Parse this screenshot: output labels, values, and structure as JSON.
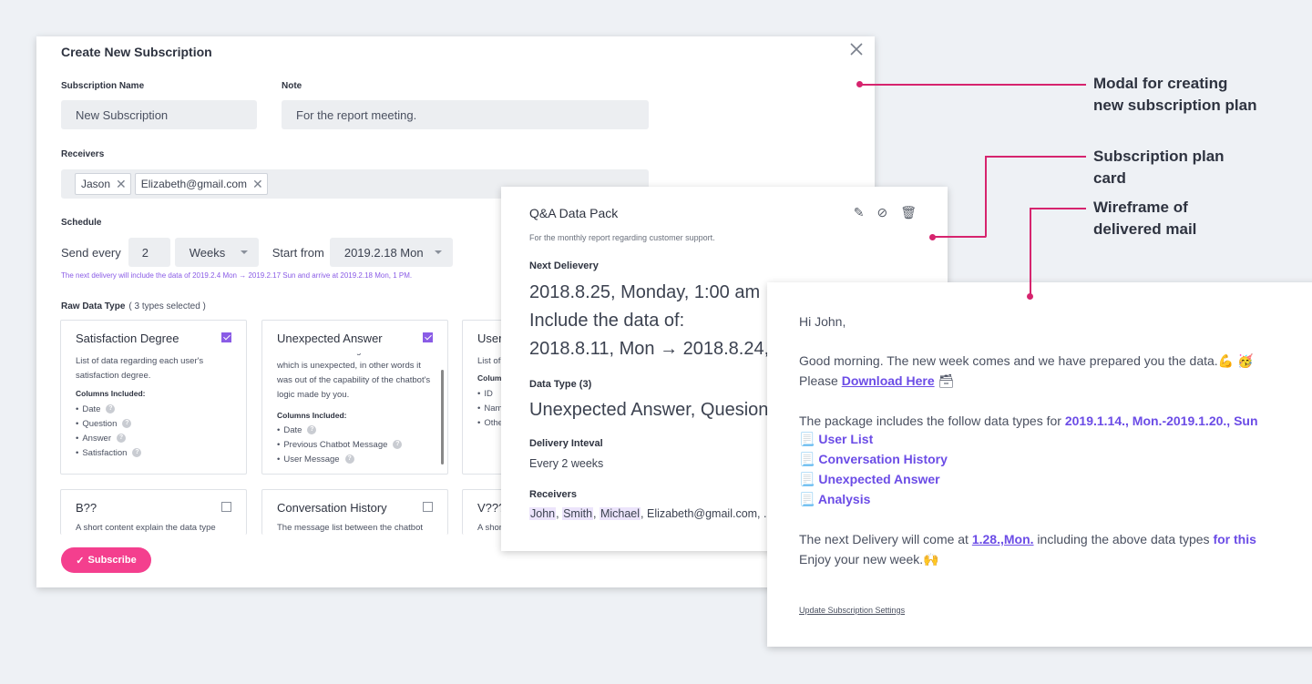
{
  "modal": {
    "title": "Create New Subscription",
    "subscription_name_label": "Subscription Name",
    "subscription_name_value": "New Subscription",
    "note_label": "Note",
    "note_value": "For the report meeting.",
    "receivers_label": "Receivers",
    "receivers": [
      "Jason",
      "Elizabeth@gmail.com"
    ],
    "schedule_label": "Schedule",
    "send_every_label": "Send every",
    "send_every_value": "2",
    "interval_unit": "Weeks",
    "start_from_label": "Start from",
    "start_date": "2019.2.18 Mon",
    "schedule_note": "The next delivery will include the data of  2019.2.4 Mon → 2019.2.17 Sun and arrive at 2019.2.18 Mon, 1 PM.",
    "raw_data_type_label": "Raw Data Type",
    "raw_data_type_count": "( 3 types selected )",
    "columns_included_label": "Columns Included:",
    "cards": [
      {
        "title": "Satisfaction Degree",
        "checked": true,
        "desc": "List of data regarding each user's satisfaction degree.",
        "columns": [
          "Date",
          "Question",
          "Answer",
          "Satisfaction"
        ]
      },
      {
        "title": "Unexpected Answer",
        "checked": true,
        "desc": "List of answers user gave in the chatbot which is unexpected, in other words it was out of the capability of the chatbot's logic made by you.",
        "columns": [
          "Date",
          "Previous Chatbot Message",
          "User Message"
        ]
      },
      {
        "title": "User",
        "checked": true,
        "desc": "List of",
        "columns_label": "Colum",
        "columns": [
          "ID",
          "Nam",
          "Othe"
        ]
      },
      {
        "title": "B??",
        "checked": false,
        "desc": "A short content explain the data type"
      },
      {
        "title": "Conversation History",
        "checked": false,
        "desc": "The message list between the chatbot"
      },
      {
        "title": "V???",
        "checked": false,
        "desc": "A shor"
      }
    ],
    "subscribe_label": "Subscribe"
  },
  "plan_card": {
    "title": "Q&A Data Pack",
    "subtitle": "For the monthly report regarding customer support.",
    "icons": [
      "edit-icon",
      "disable-icon",
      "trash-icon"
    ],
    "next_delivery_label": "Next Delievery",
    "next_delivery_line1": "2018.8.25, Monday, 1:00 am",
    "next_delivery_line2": "Include the data of:",
    "next_delivery_line3": "2018.8.11, Mon → 2018.8.24, S",
    "data_type_label": "Data Type (3)",
    "data_types": "Unexpected Answer, Quesion",
    "delivery_interval_label": "Delivery Inteval",
    "delivery_interval_value": "Every 2 weeks",
    "receivers_label": "Receivers",
    "receivers": [
      "John",
      "Smith",
      "Michael"
    ],
    "receivers_rest": ", Elizabeth@gmail.com, ."
  },
  "mail": {
    "greeting": "Hi John,",
    "line1": "Good morning. The new week comes and we have prepared you the data.💪 🥳",
    "line2_prefix": "Please ",
    "download_link": "Download Here",
    "line2_emoji": "🗃",
    "package_prefix": "The package includes the follow data types for ",
    "package_range": "2019.1.14., Mon.-2019.1.20., Sun",
    "items": [
      "User List",
      "Conversation History",
      "Unexpected Answer",
      "Analysis"
    ],
    "next_prefix": "The next Delivery will come at ",
    "next_date": "1.28.,Mon.",
    "next_mid": " including the above data types ",
    "next_suffix": "for this",
    "enjoy": "Enjoy your new week.🙌",
    "footer_link": "Update Subscription Settings"
  },
  "annotations": {
    "modal": [
      "Modal for creating",
      "new subscription plan"
    ],
    "plan": [
      "Subscription plan",
      "card"
    ],
    "mail": [
      "Wireframe of",
      "delivered mail"
    ]
  },
  "colors": {
    "accent_pink": "#f43f8e",
    "accent_purple": "#8a5ce6",
    "annotation_line": "#d6246e"
  }
}
